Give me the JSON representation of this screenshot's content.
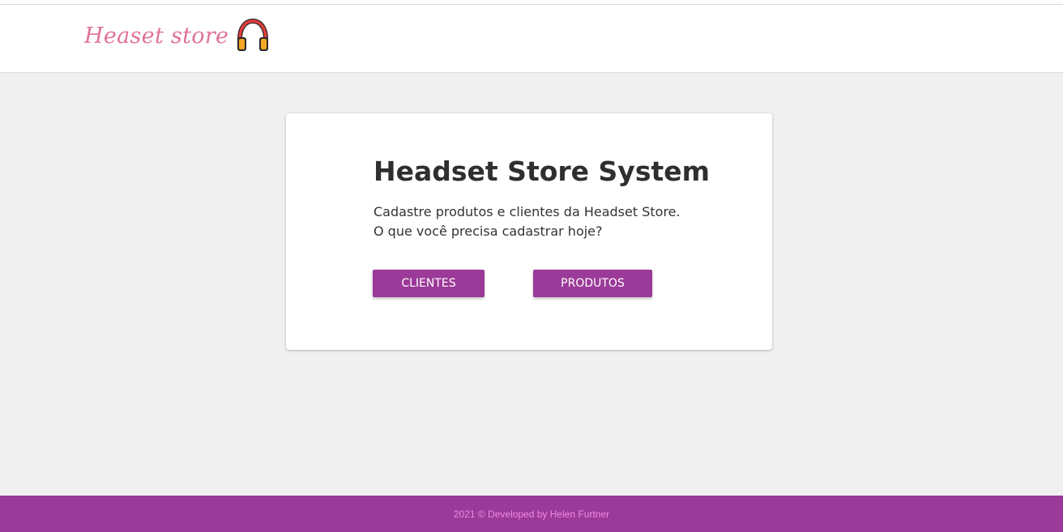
{
  "header": {
    "logo_text": "Heaset store",
    "logo_icon": "headphones-icon"
  },
  "card": {
    "title": "Headset Store System",
    "description_line1": "Cadastre produtos e clientes da Headset Store.",
    "description_line2": "O que você precisa cadastrar hoje?",
    "buttons": {
      "clientes": "CLIENTES",
      "produtos": "PRODUTOS"
    }
  },
  "footer": {
    "text": "2021 © Developed by Helen Furtner"
  },
  "colors": {
    "accent": "#9b3a98",
    "logo": "#e0729a",
    "footer_text": "#f08ae8",
    "background": "#f0f0f0"
  }
}
